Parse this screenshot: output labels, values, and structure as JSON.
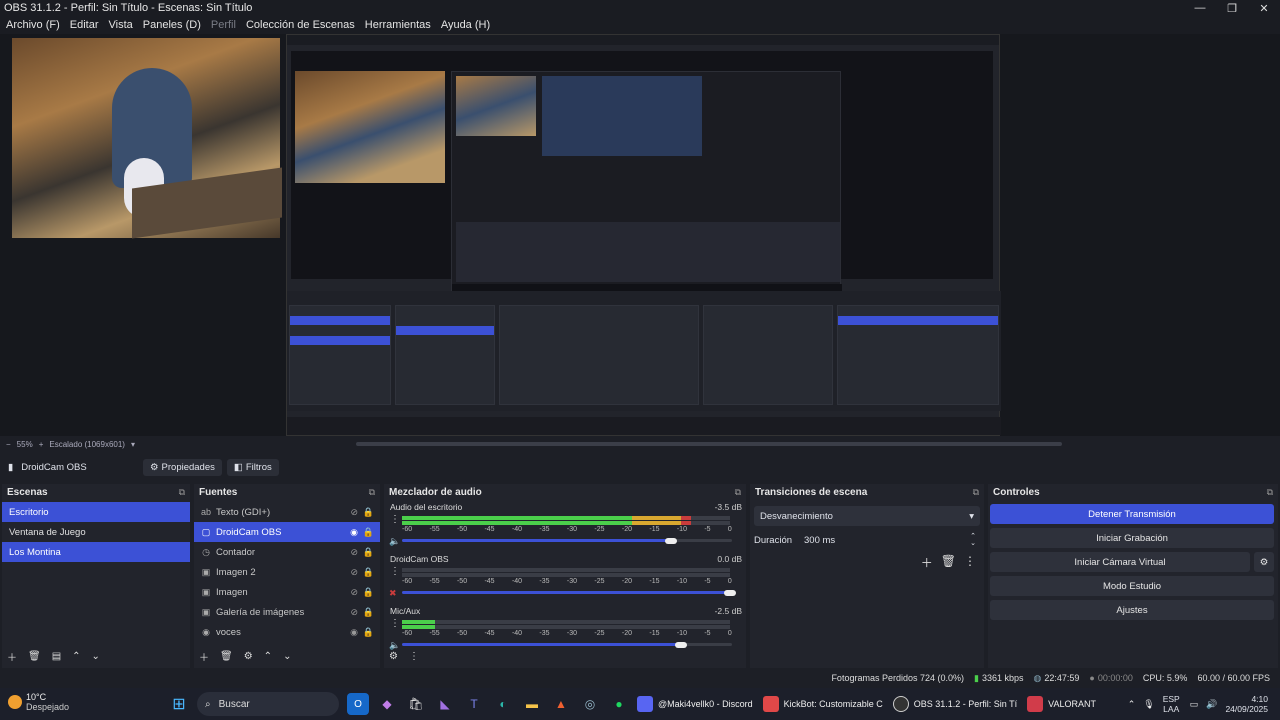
{
  "window": {
    "title": "OBS 31.1.2 - Perfil: Sin Título - Escenas: Sin Título",
    "min": "—",
    "max": "❐",
    "close": "✕"
  },
  "menu": [
    "Archivo (F)",
    "Editar",
    "Vista",
    "Paneles (D)",
    "Perfil",
    "Colección de Escenas",
    "Herramientas",
    "Ayuda (H)"
  ],
  "zoom": {
    "minus": "−",
    "value": "55%",
    "plus": "+",
    "scale": "Escalado (1069x601)",
    "arrow": "▾"
  },
  "source_bar": {
    "selected": "DroidCam OBS",
    "properties": "Propiedades",
    "filters": "Filtros"
  },
  "scenes": {
    "title": "Escenas",
    "items": [
      {
        "label": "Escritorio",
        "selected": true
      },
      {
        "label": "Ventana de Juego",
        "selected": false
      },
      {
        "label": "Los Montina",
        "selected": true
      }
    ]
  },
  "sources": {
    "title": "Fuentes",
    "items": [
      {
        "label": "Texto (GDI+)",
        "icon": "ab",
        "visible": false
      },
      {
        "label": "DroidCam OBS",
        "icon": "▢",
        "visible": true,
        "selected": true
      },
      {
        "label": "Contador",
        "icon": "◷",
        "visible": false
      },
      {
        "label": "Imagen 2",
        "icon": "▣",
        "visible": false
      },
      {
        "label": "Imagen",
        "icon": "▣",
        "visible": false
      },
      {
        "label": "Galería de imágenes",
        "icon": "▣",
        "visible": false
      },
      {
        "label": "voces",
        "icon": "◉",
        "visible": true
      }
    ]
  },
  "mixer": {
    "title": "Mezclador de audio",
    "scale": [
      "-60",
      "-55",
      "-50",
      "-45",
      "-40",
      "-35",
      "-30",
      "-25",
      "-20",
      "-15",
      "-10",
      "-5",
      "0"
    ],
    "channels": [
      {
        "name": "Audio del escritorio",
        "db": "-3.5 dB",
        "level": 0.88,
        "volume": 0.82,
        "muted": false
      },
      {
        "name": "DroidCam OBS",
        "db": "0.0 dB",
        "level": 0.0,
        "volume": 1.0,
        "muted": true
      },
      {
        "name": "Mic/Aux",
        "db": "-2.5 dB",
        "level": 0.1,
        "volume": 0.85,
        "muted": false
      }
    ]
  },
  "transitions": {
    "title": "Transiciones de escena",
    "selected": "Desvanecimiento",
    "duration_label": "Duración",
    "duration_value": "300 ms"
  },
  "controls": {
    "title": "Controles",
    "buttons": [
      {
        "label": "Detener Transmisión",
        "active": true
      },
      {
        "label": "Iniciar Grabación",
        "active": false
      },
      {
        "label": "Iniciar Cámara Virtual",
        "active": false
      },
      {
        "label": "Modo Estudio",
        "active": false
      },
      {
        "label": "Ajustes",
        "active": false
      }
    ]
  },
  "status": {
    "dropped": "Fotogramas Perdidos 724 (0.0%)",
    "bitrate": "3361 kbps",
    "live_time": "22:47:59",
    "rec_time": "00:00:00",
    "cpu": "CPU: 5.9%",
    "fps": "60.00 / 60.00 FPS"
  },
  "taskbar": {
    "weather_temp": "10°C",
    "weather_desc": "Despejado",
    "search": "Buscar",
    "apps": [
      {
        "label": "@Maki4vellk0 - Discord",
        "color": "#5865f2"
      },
      {
        "label": "KickBot: Customizable C",
        "color": "#e04848"
      },
      {
        "label": "OBS 31.1.2 - Perfil: Sin Tí",
        "color": "#333"
      },
      {
        "label": "VALORANT",
        "color": "#d13c4a"
      }
    ],
    "lang1": "ESP",
    "lang2": "LAA",
    "time": "4:10",
    "date": "24/09/2025"
  }
}
